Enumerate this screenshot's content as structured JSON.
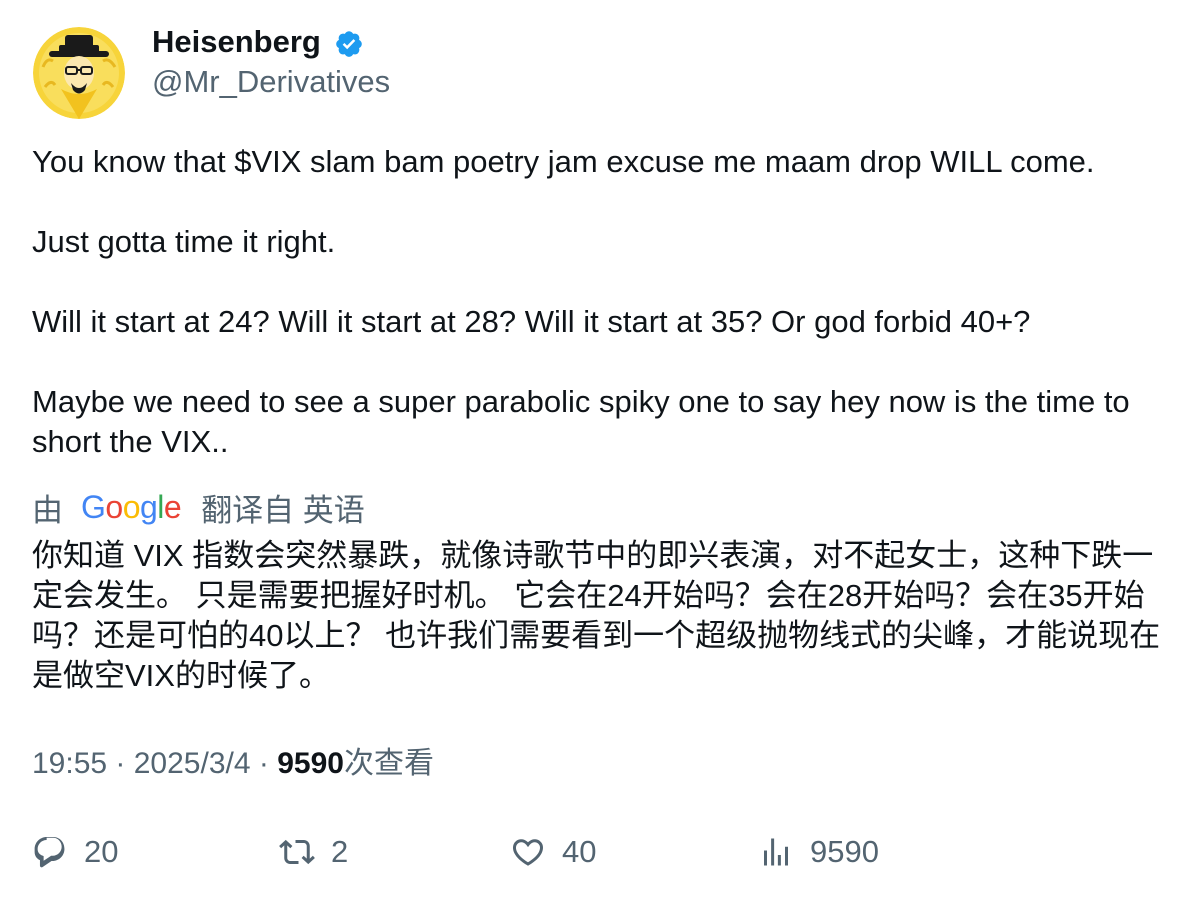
{
  "author": {
    "display_name": "Heisenberg",
    "handle": "@Mr_Derivatives",
    "verified": true,
    "verified_color": "#1d9bf0",
    "avatar_icon": "heisenberg-avatar-icon"
  },
  "tweet": {
    "paragraphs": [
      "You know that $VIX slam bam poetry jam excuse me maam drop WILL come.",
      "Just gotta time it right.",
      "Will it start at 24? Will it start at 28? Will it start at 35? Or god forbid 40+?",
      "Maybe we need to see a super parabolic spiky one to say hey now is the time to short the VIX.."
    ]
  },
  "translation": {
    "prefix": "由",
    "provider_letters": [
      "G",
      "o",
      "o",
      "g",
      "l",
      "e"
    ],
    "suffix": "翻译自 英语",
    "text": "你知道 VIX 指数会突然暴跌，就像诗歌节中的即兴表演，对不起女士，这种下跌一定会发生。 只是需要把握好时机。 它会在24开始吗？会在28开始吗？会在35开始吗？还是可怕的40以上？ 也许我们需要看到一个超级抛物线式的尖峰，才能说现在是做空VIX的时候了。"
  },
  "meta": {
    "time": "19:55",
    "separator": " · ",
    "date": "2025/3/4",
    "views": "9590",
    "views_suffix": "次查看"
  },
  "actions": {
    "reply": {
      "icon": "reply-icon",
      "count": "20"
    },
    "retweet": {
      "icon": "retweet-icon",
      "count": "2"
    },
    "like": {
      "icon": "heart-icon",
      "count": "40"
    },
    "views": {
      "icon": "analytics-icon",
      "count": "9590"
    }
  },
  "colors": {
    "text_primary": "#0f1419",
    "text_secondary": "#536471",
    "google_blue": "#4285f4",
    "google_red": "#ea4335",
    "google_yellow": "#fbbc05",
    "google_green": "#34a853"
  }
}
